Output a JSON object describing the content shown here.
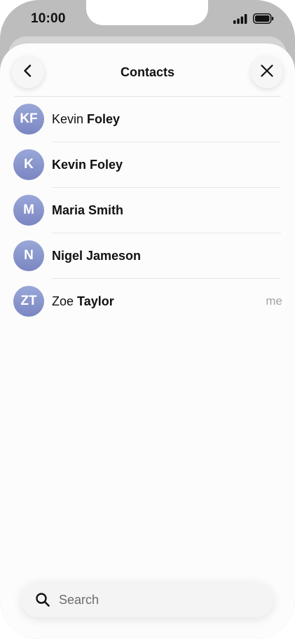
{
  "status_bar": {
    "time": "10:00",
    "icons": [
      "cellular-signal-icon",
      "battery-icon"
    ]
  },
  "header": {
    "title": "Contacts",
    "back_icon": "chevron-left-icon",
    "close_icon": "close-icon"
  },
  "contacts": [
    {
      "initials": "KF",
      "first_name": "Kevin",
      "last_name": "Foley",
      "tag": ""
    },
    {
      "initials": "K",
      "full_name": "Kevin Foley",
      "tag": ""
    },
    {
      "initials": "M",
      "full_name": "Maria Smith",
      "tag": ""
    },
    {
      "initials": "N",
      "full_name": "Nigel Jameson",
      "tag": ""
    },
    {
      "initials": "ZT",
      "first_name": "Zoe",
      "last_name": "Taylor",
      "tag": "me"
    }
  ],
  "search": {
    "placeholder": "Search",
    "value": "",
    "icon": "search-icon"
  },
  "colors": {
    "avatar_top": "#99a7d8",
    "avatar_bottom": "#7b86c2",
    "muted_text": "#a3a3a3"
  }
}
